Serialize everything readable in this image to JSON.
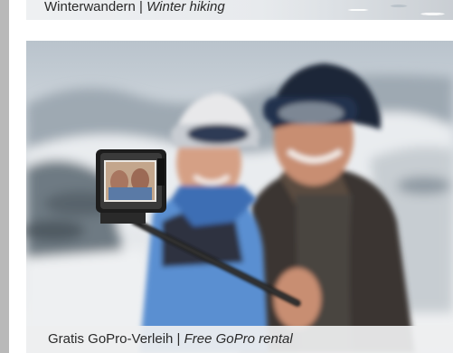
{
  "cards": [
    {
      "caption_de": "Winterwandern",
      "separator": " | ",
      "caption_en": "Winter hiking",
      "image_icon": "winter-landscape-photo"
    },
    {
      "caption_de": "Gratis GoPro-Verleih",
      "separator": " | ",
      "caption_en": "Free GoPro rental",
      "image_icon": "couple-selfie-gopro-photo"
    }
  ],
  "colors": {
    "gutter": "#b9b9b9",
    "caption_bg": "#eeeff0",
    "caption_text": "#2a2a2a"
  }
}
